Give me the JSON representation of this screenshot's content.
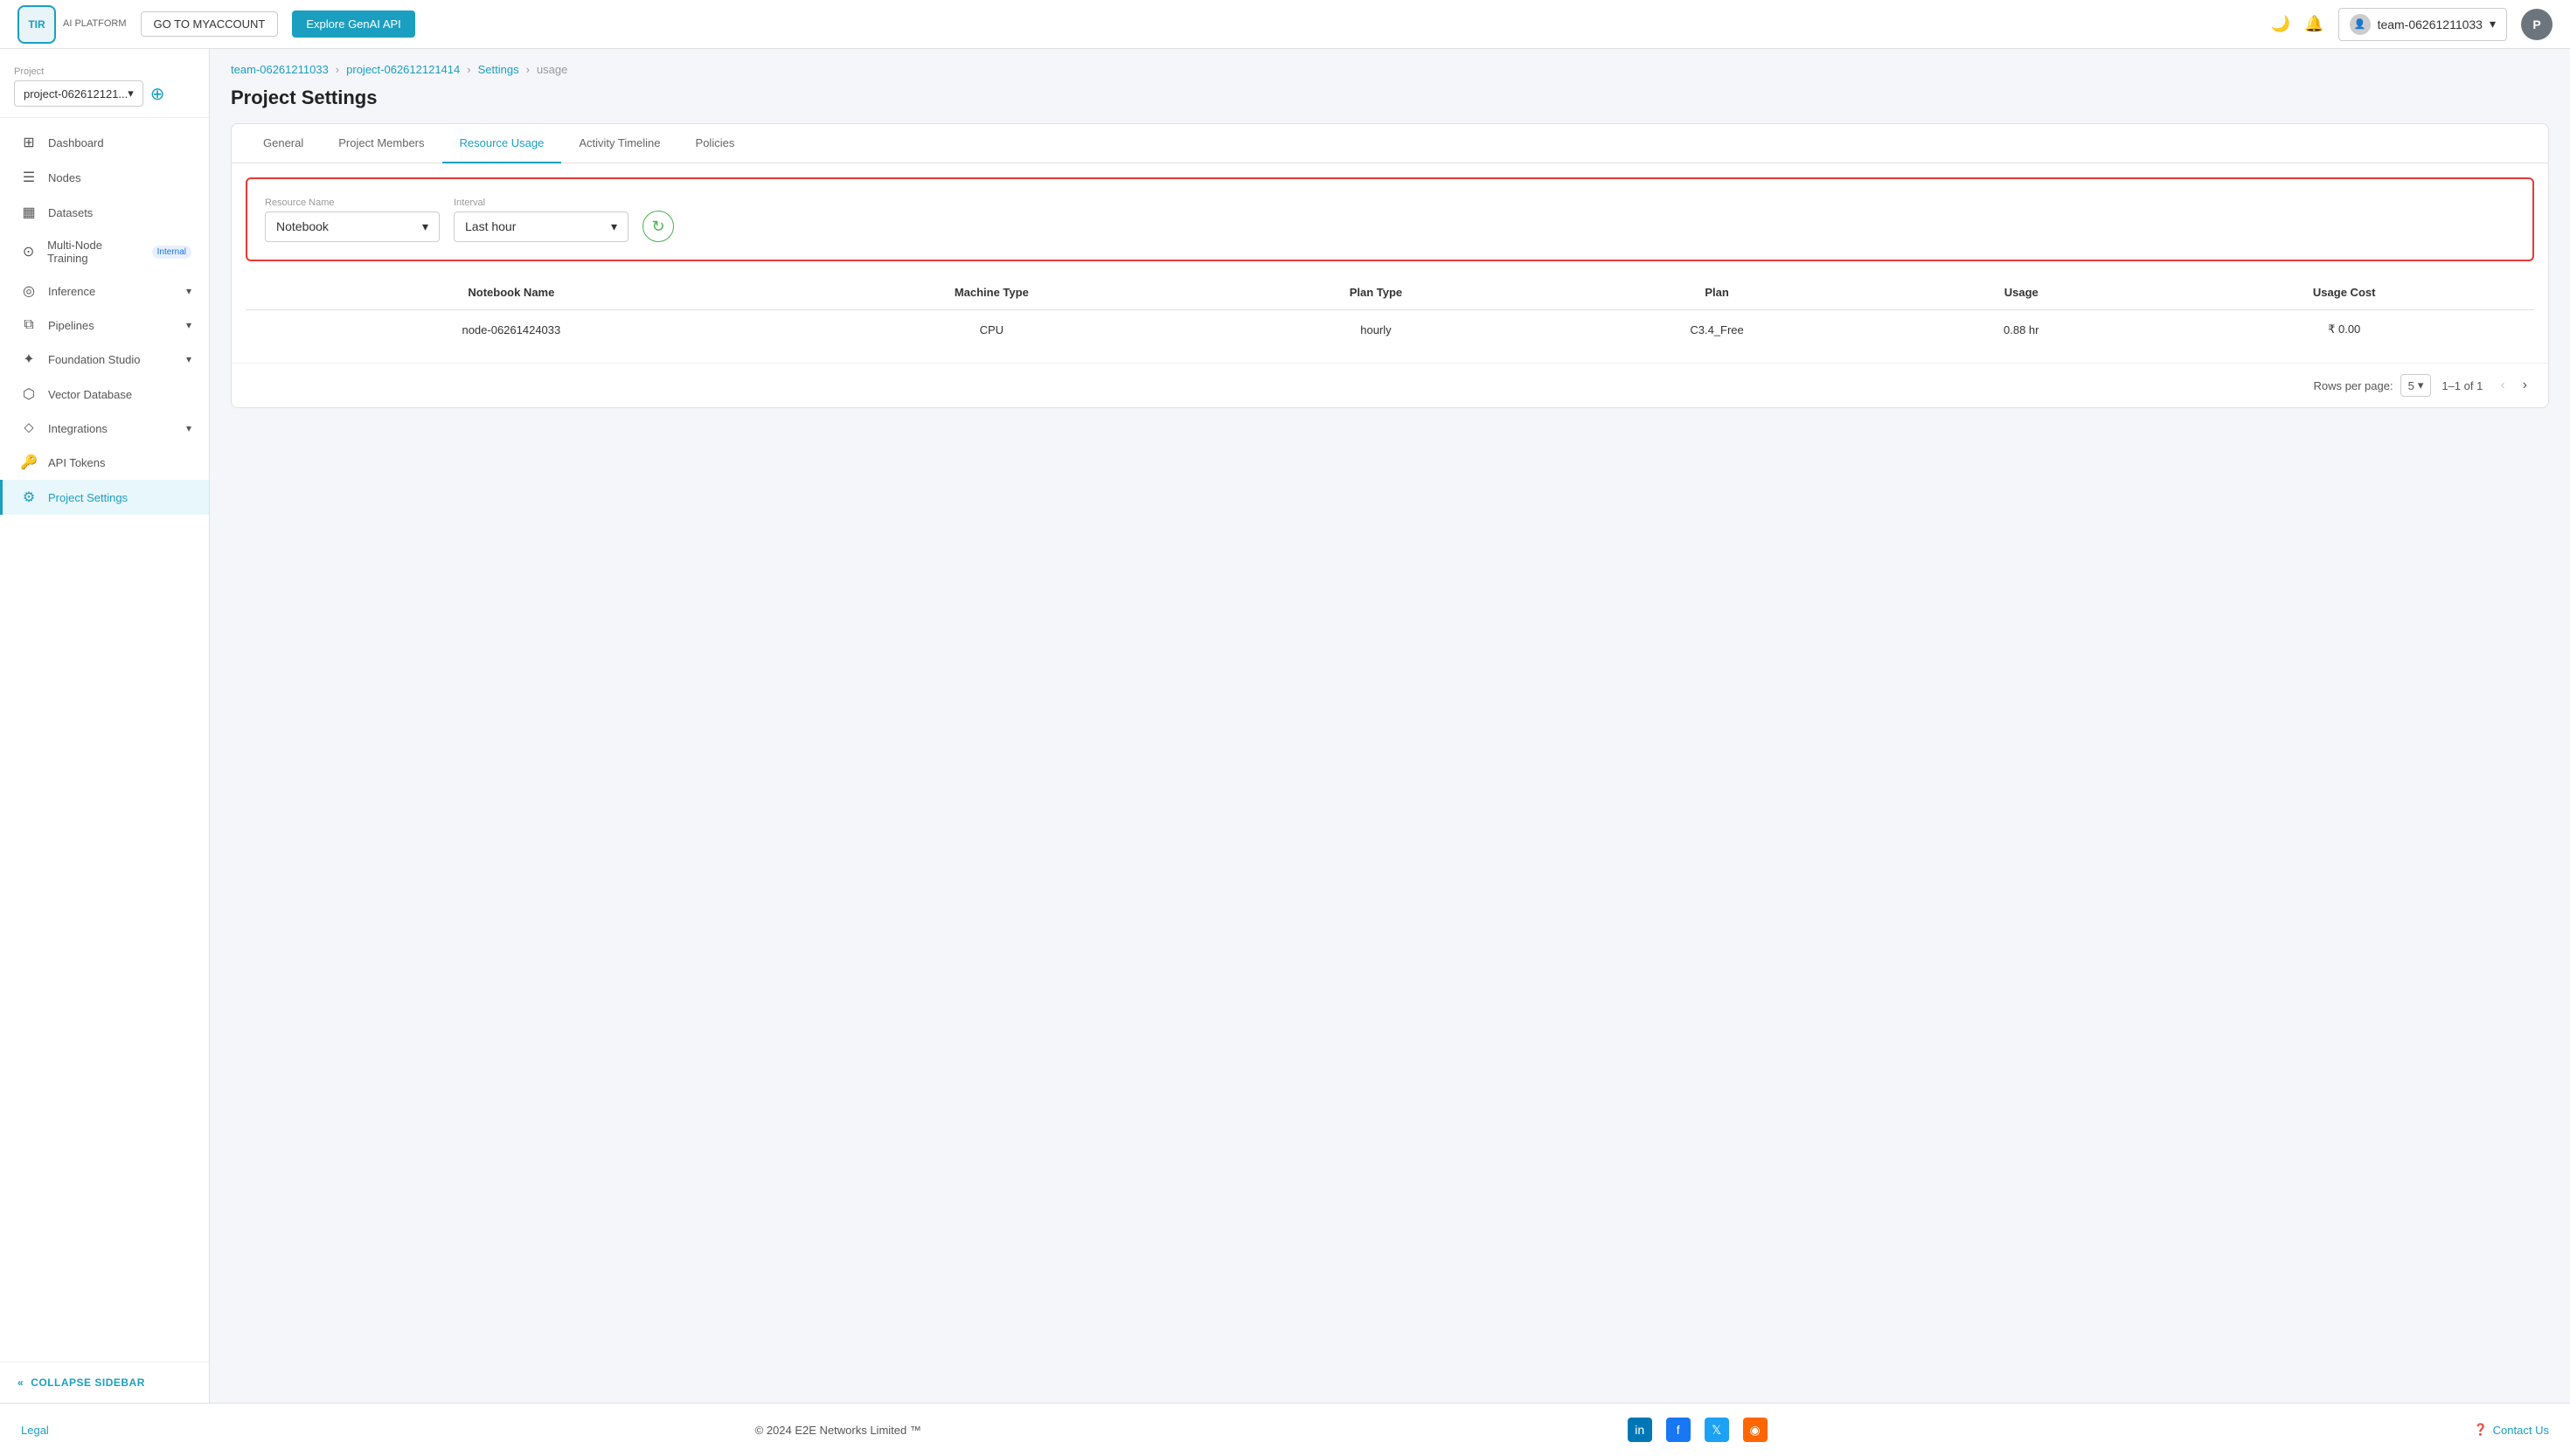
{
  "header": {
    "logo_text": "TIR\nAI PLATFORM",
    "btn_myaccount": "GO TO MYACCOUNT",
    "btn_genai": "Explore GenAI API",
    "team_name": "team-06261211033",
    "user_initial": "P"
  },
  "sidebar": {
    "project_label": "Project",
    "project_value": "project-062612121...",
    "nav_items": [
      {
        "id": "dashboard",
        "label": "Dashboard",
        "icon": "⊞"
      },
      {
        "id": "nodes",
        "label": "Nodes",
        "icon": "☰"
      },
      {
        "id": "datasets",
        "label": "Datasets",
        "icon": "▦"
      },
      {
        "id": "multi-node",
        "label": "Multi-Node Training",
        "icon": "⊙",
        "badge": "Internal"
      },
      {
        "id": "inference",
        "label": "Inference",
        "icon": "◎",
        "chevron": "▾"
      },
      {
        "id": "pipelines",
        "label": "Pipelines",
        "icon": "⧉",
        "chevron": "▾"
      },
      {
        "id": "foundation-studio",
        "label": "Foundation Studio",
        "icon": "✦",
        "chevron": "▾"
      },
      {
        "id": "vector-database",
        "label": "Vector Database",
        "icon": "⬡"
      },
      {
        "id": "integrations",
        "label": "Integrations",
        "icon": "⬦",
        "chevron": "▾"
      },
      {
        "id": "api-tokens",
        "label": "API Tokens",
        "icon": "🔑"
      },
      {
        "id": "project-settings",
        "label": "Project Settings",
        "icon": "⚙",
        "active": true
      }
    ],
    "collapse_label": "COLLAPSE SIDEBAR"
  },
  "breadcrumb": {
    "parts": [
      {
        "label": "team-06261211033",
        "link": true
      },
      {
        "label": "project-062612121414",
        "link": true
      },
      {
        "label": "Settings",
        "link": true
      },
      {
        "label": "usage",
        "link": false
      }
    ]
  },
  "page": {
    "title": "Project Settings"
  },
  "tabs": [
    {
      "id": "general",
      "label": "General",
      "active": false
    },
    {
      "id": "members",
      "label": "Project Members",
      "active": false
    },
    {
      "id": "resource-usage",
      "label": "Resource Usage",
      "active": true
    },
    {
      "id": "activity-timeline",
      "label": "Activity Timeline",
      "active": false
    },
    {
      "id": "policies",
      "label": "Policies",
      "active": false
    }
  ],
  "filters": {
    "resource_name_label": "Resource Name",
    "resource_name_value": "Notebook",
    "interval_label": "Interval",
    "interval_value": "Last hour"
  },
  "table": {
    "columns": [
      "Notebook Name",
      "Machine Type",
      "Plan Type",
      "Plan",
      "Usage",
      "Usage Cost"
    ],
    "rows": [
      {
        "notebook_name": "node-06261424033",
        "machine_type": "CPU",
        "plan_type": "hourly",
        "plan": "C3.4_Free",
        "usage": "0.88 hr",
        "usage_cost": "₹ 0.00"
      }
    ]
  },
  "pagination": {
    "rows_per_page_label": "Rows per page:",
    "rows_per_page_value": "5",
    "page_info": "1–1 of 1"
  },
  "footer": {
    "legal": "Legal",
    "copyright": "© 2024 E2E Networks Limited ™",
    "contact_us": "Contact Us"
  }
}
